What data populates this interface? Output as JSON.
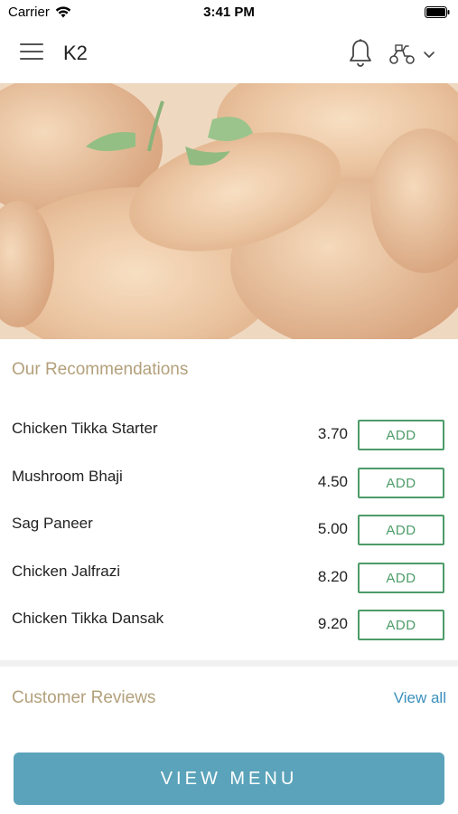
{
  "status_bar": {
    "carrier": "Carrier",
    "time": "3:41 PM"
  },
  "header": {
    "title": "K2",
    "icons": [
      "menu-icon",
      "bell-icon",
      "scooter-icon",
      "chevron-down-icon"
    ]
  },
  "recommendations": {
    "title": "Our Recommendations",
    "add_label": "ADD",
    "items": [
      {
        "name": "Chicken Tikka Starter",
        "price": "3.70"
      },
      {
        "name": "Mushroom Bhaji",
        "price": "4.50"
      },
      {
        "name": "Sag Paneer",
        "price": "5.00"
      },
      {
        "name": "Chicken Jalfrazi",
        "price": "8.20"
      },
      {
        "name": "Chicken Tikka Dansak",
        "price": "9.20"
      }
    ]
  },
  "reviews": {
    "title": "Customer Reviews",
    "view_all": "View all"
  },
  "footer": {
    "view_menu": "VIEW MENU"
  },
  "colors": {
    "accent_green": "#4c9b68",
    "section_title": "#b3a07b",
    "link_blue": "#3a8fbd",
    "button_teal": "#5ba3ba"
  }
}
